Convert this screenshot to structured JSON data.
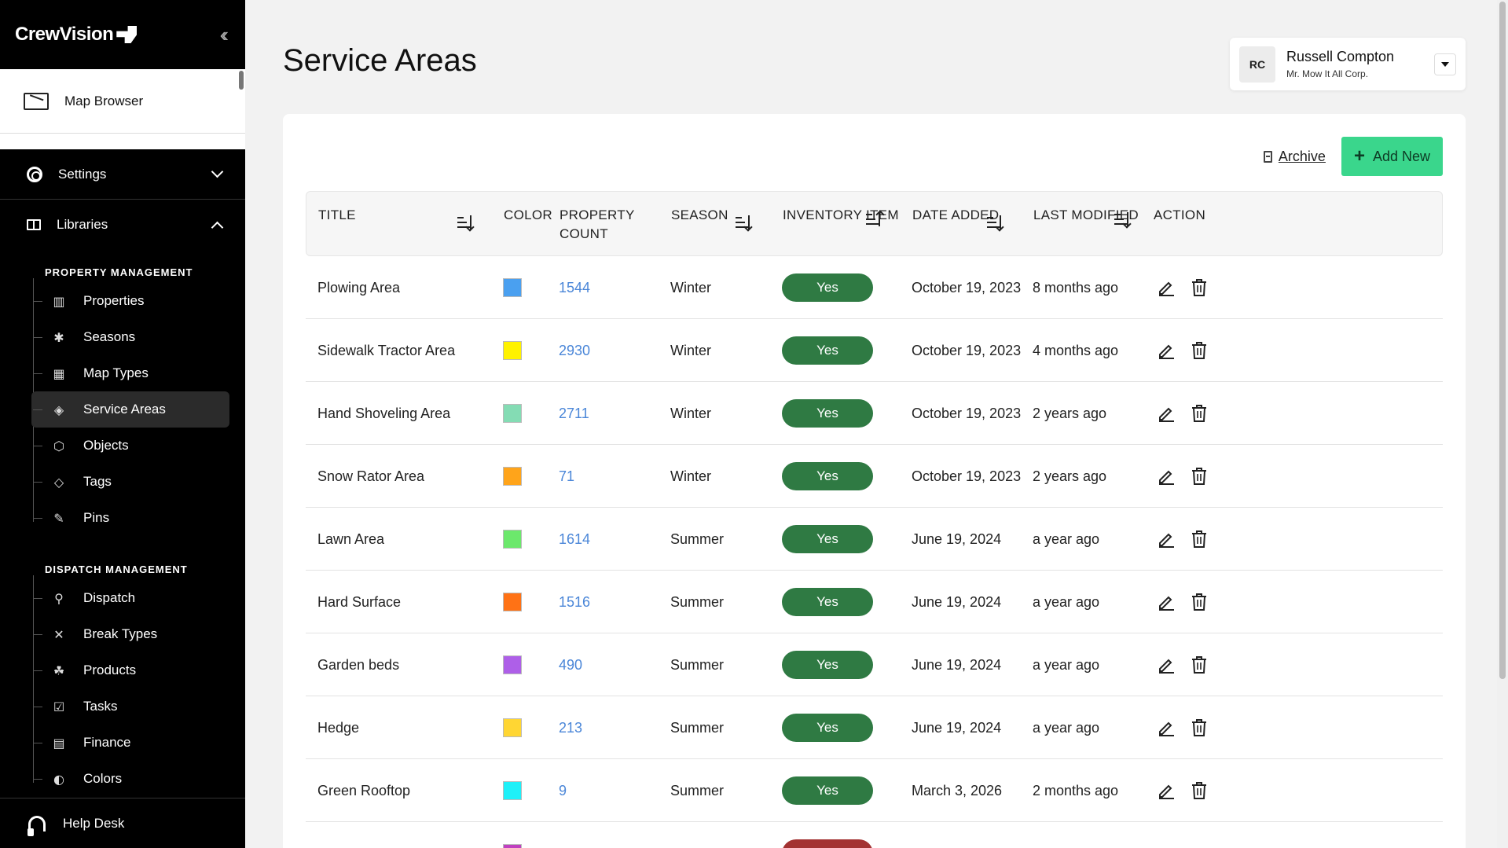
{
  "brand": {
    "name": "CrewVision"
  },
  "sidebar": {
    "top_item": "Map Browser",
    "settings_label": "Settings",
    "libraries_label": "Libraries",
    "groups": [
      {
        "label": "PROPERTY MANAGEMENT",
        "items": [
          {
            "label": "Properties",
            "icon": "building-icon",
            "glyph": "▥"
          },
          {
            "label": "Seasons",
            "icon": "snowflake-icon",
            "glyph": "✱"
          },
          {
            "label": "Map Types",
            "icon": "map-icon",
            "glyph": "▦"
          },
          {
            "label": "Service Areas",
            "icon": "layers-icon",
            "glyph": "◈",
            "active": true
          },
          {
            "label": "Objects",
            "icon": "cube-icon",
            "glyph": "⬡"
          },
          {
            "label": "Tags",
            "icon": "tag-icon",
            "glyph": "◇"
          },
          {
            "label": "Pins",
            "icon": "pin-icon",
            "glyph": "✎"
          }
        ]
      },
      {
        "label": "DISPATCH MANAGEMENT",
        "items": [
          {
            "label": "Dispatch",
            "icon": "dispatch-icon",
            "glyph": "⚲"
          },
          {
            "label": "Break Types",
            "icon": "tools-icon",
            "glyph": "✕"
          },
          {
            "label": "Products",
            "icon": "boxes-icon",
            "glyph": "☘"
          },
          {
            "label": "Tasks",
            "icon": "checkbox-icon",
            "glyph": "☑"
          },
          {
            "label": "Finance",
            "icon": "finance-icon",
            "glyph": "▤"
          },
          {
            "label": "Colors",
            "icon": "palette-icon",
            "glyph": "◐"
          }
        ]
      }
    ],
    "help_label": "Help Desk"
  },
  "page": {
    "title": "Service Areas"
  },
  "user": {
    "initials": "RC",
    "name": "Russell Compton",
    "org": "Mr. Mow It All Corp."
  },
  "toolbar": {
    "archive_label": "Archive",
    "add_label": "Add New"
  },
  "table": {
    "headers": {
      "title": "TITLE",
      "color": "COLOR",
      "property_count_1": "PROPERTY",
      "property_count_2": "COUNT",
      "season": "SEASON",
      "inventory": "INVENTORY ITEM",
      "date_added": "DATE ADDED",
      "last_modified": "LAST MODIFIED",
      "action": "ACTION"
    },
    "rows": [
      {
        "title": "Plowing Area",
        "color": "#4aa0f0",
        "count": "1544",
        "season": "Winter",
        "inventory": "Yes",
        "date_added": "October 19, 2023",
        "last_modified": "8 months ago"
      },
      {
        "title": "Sidewalk Tractor Area",
        "color": "#fff200",
        "count": "2930",
        "season": "Winter",
        "inventory": "Yes",
        "date_added": "October 19, 2023",
        "last_modified": "4 months ago"
      },
      {
        "title": "Hand Shoveling Area",
        "color": "#84dcb4",
        "count": "2711",
        "season": "Winter",
        "inventory": "Yes",
        "date_added": "October 19, 2023",
        "last_modified": "2 years ago"
      },
      {
        "title": "Snow Rator Area",
        "color": "#ffa41a",
        "count": "71",
        "season": "Winter",
        "inventory": "Yes",
        "date_added": "October 19, 2023",
        "last_modified": "2 years ago"
      },
      {
        "title": "Lawn Area",
        "color": "#6ce86c",
        "count": "1614",
        "season": "Summer",
        "inventory": "Yes",
        "date_added": "June 19, 2024",
        "last_modified": "a year ago"
      },
      {
        "title": "Hard Surface",
        "color": "#ff7215",
        "count": "1516",
        "season": "Summer",
        "inventory": "Yes",
        "date_added": "June 19, 2024",
        "last_modified": "a year ago"
      },
      {
        "title": "Garden beds",
        "color": "#ae5fe8",
        "count": "490",
        "season": "Summer",
        "inventory": "Yes",
        "date_added": "June 19, 2024",
        "last_modified": "a year ago"
      },
      {
        "title": "Hedge",
        "color": "#ffd633",
        "count": "213",
        "season": "Summer",
        "inventory": "Yes",
        "date_added": "June 19, 2024",
        "last_modified": "a year ago"
      },
      {
        "title": "Green Rooftop",
        "color": "#1ef0f8",
        "count": "9",
        "season": "Summer",
        "inventory": "Yes",
        "date_added": "March 3, 2026",
        "last_modified": "2 months ago"
      },
      {
        "title": "",
        "color": "#c040c0",
        "count": "",
        "season": "",
        "inventory": "",
        "date_added": "",
        "last_modified": "",
        "inventory_status": "no"
      }
    ]
  },
  "colors": {
    "accent_green": "#3ad68c",
    "pill_yes": "#2f7a43",
    "pill_no": "#a33232",
    "link_blue": "#4a86d8"
  }
}
